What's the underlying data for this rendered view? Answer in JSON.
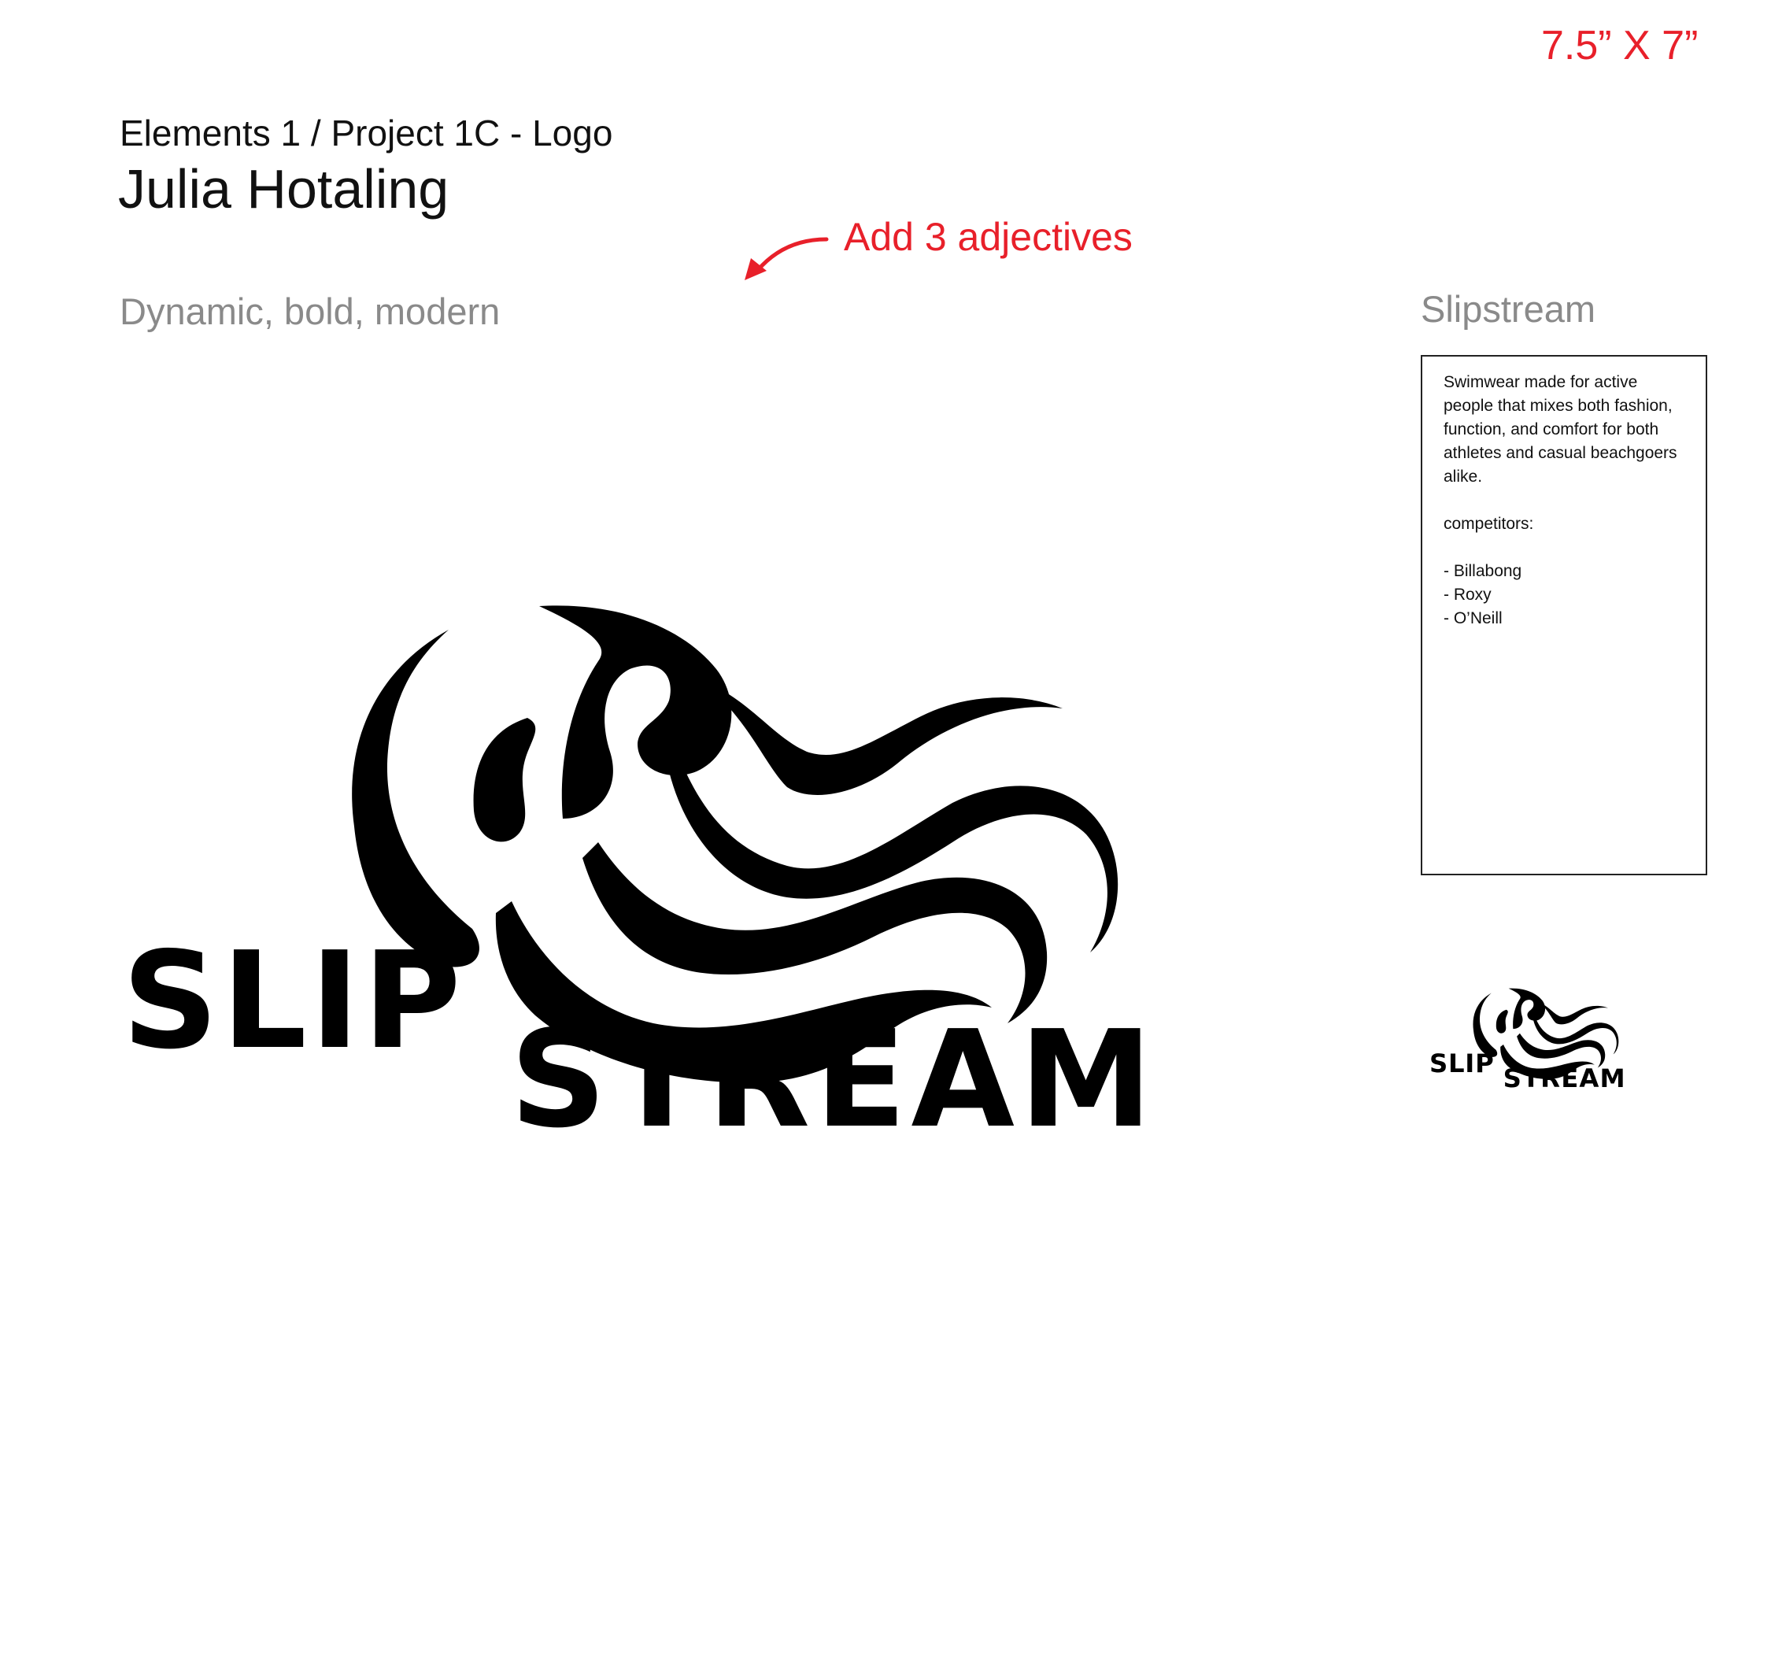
{
  "header": {
    "size_label": "7.5” X 7”",
    "project_line": "Elements 1 / Project 1C - Logo",
    "designer_name": "Julia Hotaling"
  },
  "annotation": {
    "note": "Add 3 adjectives"
  },
  "adjectives": "Dynamic, bold, modern",
  "brand": {
    "title": "Slipstream",
    "description": "Swimwear made for active people that mixes both fashion, function, and comfort for both athletes and casual beachgoers alike.",
    "competitors_label": "competitors:",
    "competitors": [
      "- Billabong",
      "- Roxy",
      "- O’Neill"
    ]
  },
  "logo": {
    "word_top": "SLIP",
    "word_bottom": "STREAM"
  },
  "colors": {
    "accent_red": "#e8202a",
    "muted_gray": "#8a8a8a",
    "ink": "#000000"
  }
}
